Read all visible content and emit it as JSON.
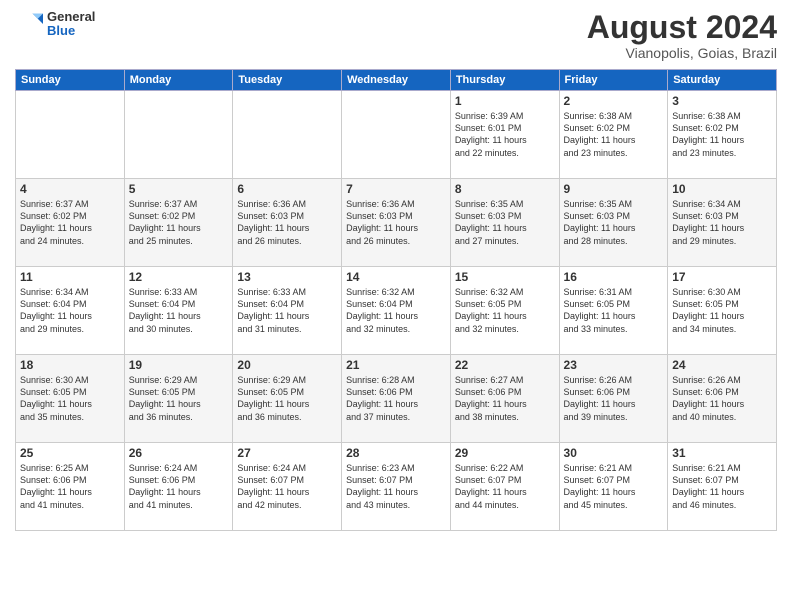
{
  "header": {
    "logo_general": "General",
    "logo_blue": "Blue",
    "month_year": "August 2024",
    "location": "Vianopolis, Goias, Brazil"
  },
  "weekdays": [
    "Sunday",
    "Monday",
    "Tuesday",
    "Wednesday",
    "Thursday",
    "Friday",
    "Saturday"
  ],
  "weeks": [
    [
      {
        "day": "",
        "info": ""
      },
      {
        "day": "",
        "info": ""
      },
      {
        "day": "",
        "info": ""
      },
      {
        "day": "",
        "info": ""
      },
      {
        "day": "1",
        "info": "Sunrise: 6:39 AM\nSunset: 6:01 PM\nDaylight: 11 hours\nand 22 minutes."
      },
      {
        "day": "2",
        "info": "Sunrise: 6:38 AM\nSunset: 6:02 PM\nDaylight: 11 hours\nand 23 minutes."
      },
      {
        "day": "3",
        "info": "Sunrise: 6:38 AM\nSunset: 6:02 PM\nDaylight: 11 hours\nand 23 minutes."
      }
    ],
    [
      {
        "day": "4",
        "info": "Sunrise: 6:37 AM\nSunset: 6:02 PM\nDaylight: 11 hours\nand 24 minutes."
      },
      {
        "day": "5",
        "info": "Sunrise: 6:37 AM\nSunset: 6:02 PM\nDaylight: 11 hours\nand 25 minutes."
      },
      {
        "day": "6",
        "info": "Sunrise: 6:36 AM\nSunset: 6:03 PM\nDaylight: 11 hours\nand 26 minutes."
      },
      {
        "day": "7",
        "info": "Sunrise: 6:36 AM\nSunset: 6:03 PM\nDaylight: 11 hours\nand 26 minutes."
      },
      {
        "day": "8",
        "info": "Sunrise: 6:35 AM\nSunset: 6:03 PM\nDaylight: 11 hours\nand 27 minutes."
      },
      {
        "day": "9",
        "info": "Sunrise: 6:35 AM\nSunset: 6:03 PM\nDaylight: 11 hours\nand 28 minutes."
      },
      {
        "day": "10",
        "info": "Sunrise: 6:34 AM\nSunset: 6:03 PM\nDaylight: 11 hours\nand 29 minutes."
      }
    ],
    [
      {
        "day": "11",
        "info": "Sunrise: 6:34 AM\nSunset: 6:04 PM\nDaylight: 11 hours\nand 29 minutes."
      },
      {
        "day": "12",
        "info": "Sunrise: 6:33 AM\nSunset: 6:04 PM\nDaylight: 11 hours\nand 30 minutes."
      },
      {
        "day": "13",
        "info": "Sunrise: 6:33 AM\nSunset: 6:04 PM\nDaylight: 11 hours\nand 31 minutes."
      },
      {
        "day": "14",
        "info": "Sunrise: 6:32 AM\nSunset: 6:04 PM\nDaylight: 11 hours\nand 32 minutes."
      },
      {
        "day": "15",
        "info": "Sunrise: 6:32 AM\nSunset: 6:05 PM\nDaylight: 11 hours\nand 32 minutes."
      },
      {
        "day": "16",
        "info": "Sunrise: 6:31 AM\nSunset: 6:05 PM\nDaylight: 11 hours\nand 33 minutes."
      },
      {
        "day": "17",
        "info": "Sunrise: 6:30 AM\nSunset: 6:05 PM\nDaylight: 11 hours\nand 34 minutes."
      }
    ],
    [
      {
        "day": "18",
        "info": "Sunrise: 6:30 AM\nSunset: 6:05 PM\nDaylight: 11 hours\nand 35 minutes."
      },
      {
        "day": "19",
        "info": "Sunrise: 6:29 AM\nSunset: 6:05 PM\nDaylight: 11 hours\nand 36 minutes."
      },
      {
        "day": "20",
        "info": "Sunrise: 6:29 AM\nSunset: 6:05 PM\nDaylight: 11 hours\nand 36 minutes."
      },
      {
        "day": "21",
        "info": "Sunrise: 6:28 AM\nSunset: 6:06 PM\nDaylight: 11 hours\nand 37 minutes."
      },
      {
        "day": "22",
        "info": "Sunrise: 6:27 AM\nSunset: 6:06 PM\nDaylight: 11 hours\nand 38 minutes."
      },
      {
        "day": "23",
        "info": "Sunrise: 6:26 AM\nSunset: 6:06 PM\nDaylight: 11 hours\nand 39 minutes."
      },
      {
        "day": "24",
        "info": "Sunrise: 6:26 AM\nSunset: 6:06 PM\nDaylight: 11 hours\nand 40 minutes."
      }
    ],
    [
      {
        "day": "25",
        "info": "Sunrise: 6:25 AM\nSunset: 6:06 PM\nDaylight: 11 hours\nand 41 minutes."
      },
      {
        "day": "26",
        "info": "Sunrise: 6:24 AM\nSunset: 6:06 PM\nDaylight: 11 hours\nand 41 minutes."
      },
      {
        "day": "27",
        "info": "Sunrise: 6:24 AM\nSunset: 6:07 PM\nDaylight: 11 hours\nand 42 minutes."
      },
      {
        "day": "28",
        "info": "Sunrise: 6:23 AM\nSunset: 6:07 PM\nDaylight: 11 hours\nand 43 minutes."
      },
      {
        "day": "29",
        "info": "Sunrise: 6:22 AM\nSunset: 6:07 PM\nDaylight: 11 hours\nand 44 minutes."
      },
      {
        "day": "30",
        "info": "Sunrise: 6:21 AM\nSunset: 6:07 PM\nDaylight: 11 hours\nand 45 minutes."
      },
      {
        "day": "31",
        "info": "Sunrise: 6:21 AM\nSunset: 6:07 PM\nDaylight: 11 hours\nand 46 minutes."
      }
    ]
  ]
}
